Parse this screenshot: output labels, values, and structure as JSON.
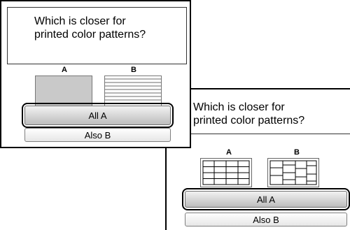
{
  "screen1": {
    "question": {
      "line1": "Which is closer for",
      "line2": "printed color patterns?"
    },
    "options": {
      "a_label": "A",
      "b_label": "B"
    },
    "buttons": {
      "primary_label": "All A",
      "secondary_label": "Also B"
    }
  },
  "screen2": {
    "question": {
      "line1": "Which is closer for",
      "line2": "printed color patterns?"
    },
    "options": {
      "a_label": "A",
      "b_label": "B"
    },
    "buttons": {
      "primary_label": "All A",
      "secondary_label": "Also B"
    }
  },
  "colors": {
    "border": "#000000",
    "thumb_gray": "#c9c9c9",
    "button_gradient_top": "#f2f2f2",
    "button_gradient_bottom": "#bdbdbd"
  }
}
